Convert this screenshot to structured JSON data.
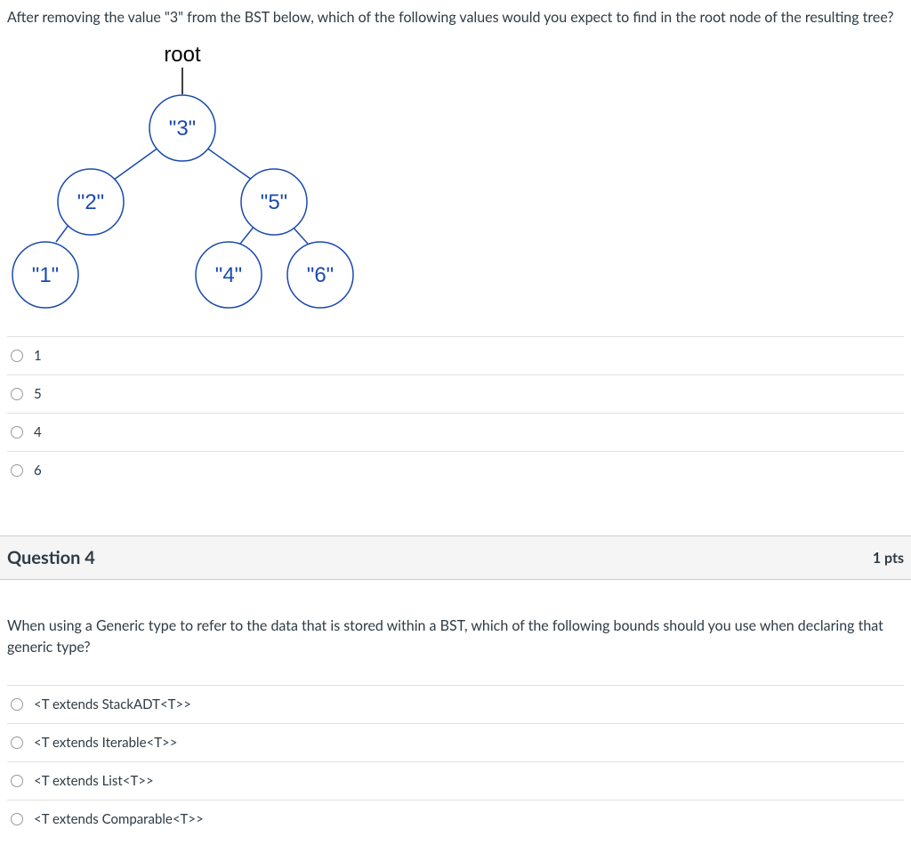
{
  "q3": {
    "text": "After removing the value \"3\" from the BST below, which of the following values would you expect to find in the root node of the resulting tree?",
    "diagram": {
      "root_label": "root",
      "nodes": {
        "n3": "\"3\"",
        "n2": "\"2\"",
        "n5": "\"5\"",
        "n1": "\"1\"",
        "n4": "\"4\"",
        "n6": "\"6\""
      }
    },
    "answers": [
      "1",
      "5",
      "4",
      "6"
    ]
  },
  "q4": {
    "header": "Question 4",
    "points": "1 pts",
    "text": "When using a Generic type to refer to the data that is stored within a BST, which of the following bounds should you use when declaring that generic type?",
    "answers": [
      "<T extends StackADT<T>>",
      "<T extends Iterable<T>>",
      "<T extends List<T>>",
      "<T extends Comparable<T>>"
    ]
  }
}
